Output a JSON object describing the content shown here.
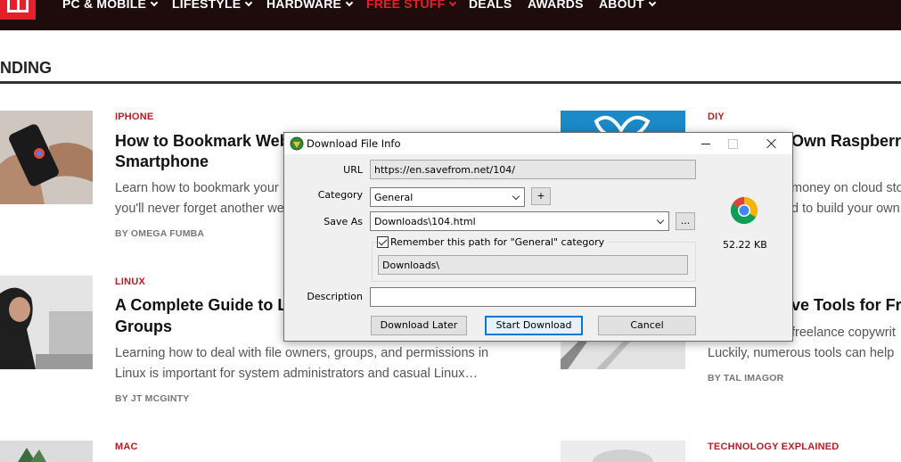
{
  "nav": {
    "items": [
      {
        "label": "PC & MOBILE",
        "has_dropdown": true,
        "active": false
      },
      {
        "label": "LIFESTYLE",
        "has_dropdown": true,
        "active": false
      },
      {
        "label": "HARDWARE",
        "has_dropdown": true,
        "active": false
      },
      {
        "label": "FREE STUFF",
        "has_dropdown": true,
        "active": true
      },
      {
        "label": "DEALS",
        "has_dropdown": false,
        "active": false
      },
      {
        "label": "AWARDS",
        "has_dropdown": false,
        "active": false
      },
      {
        "label": "ABOUT",
        "has_dropdown": true,
        "active": false
      }
    ],
    "active_color": "#e5202b",
    "bar_color": "#1e0c0c"
  },
  "section": {
    "title": "NDING"
  },
  "articles_left": [
    {
      "category": "IPHONE",
      "title_lines": [
        "How to Bookmark Web",
        "Smartphone"
      ],
      "excerpt_lines": [
        "Learn how to bookmark your",
        "you'll never forget another we"
      ],
      "byline": "BY OMEGA FUMBA"
    },
    {
      "category": "LINUX",
      "title_lines": [
        "A Complete Guide to L",
        "Groups"
      ],
      "excerpt_lines": [
        "Learning how to deal with file owners, groups, and permissions in",
        "Linux is important for system administrators and casual Linux…"
      ],
      "byline": "BY JT MCGINTY"
    },
    {
      "category": "MAC"
    }
  ],
  "articles_right": [
    {
      "category": "DIY",
      "title_lines": [
        "Own Raspberry"
      ],
      "excerpt_lines": [
        "money on cloud sto",
        "d to build your own"
      ]
    },
    {
      "title_lines": [
        "ve Tools for Fre"
      ],
      "excerpt_lines": [
        "freelance copywrit",
        "Luckily, numerous tools can help"
      ],
      "byline": "BY TAL IMAGOR"
    },
    {
      "category": "TECHNOLOGY EXPLAINED"
    }
  ],
  "dialog": {
    "title": "Download File Info",
    "url_label": "URL",
    "url_value": "https://en.savefrom.net/104/",
    "category_label": "Category",
    "category_value": "General",
    "add_category_label": "+",
    "save_as_label": "Save As",
    "save_as_value": "Downloads\\104.html",
    "browse_label": "...",
    "remember_label": "Remember this path for \"General\" category",
    "remember_checked": true,
    "path_value": "Downloads\\",
    "description_label": "Description",
    "description_value": "",
    "file_size": "52.22  KB",
    "file_icon": "chrome-icon",
    "buttons": {
      "download_later": "Download Later",
      "start_download": "Start Download",
      "cancel": "Cancel"
    }
  }
}
